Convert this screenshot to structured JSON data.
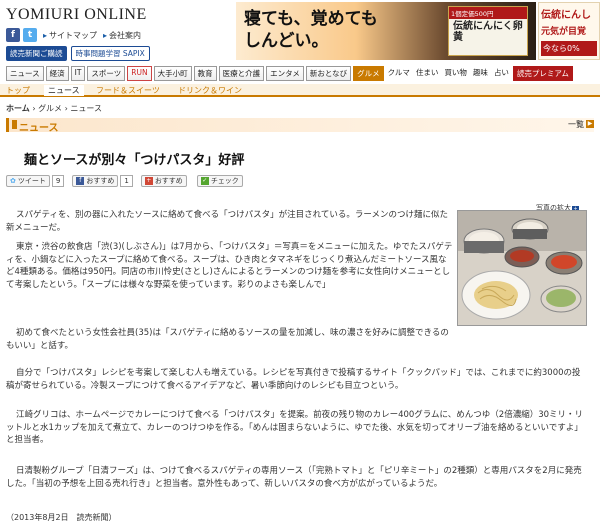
{
  "header": {
    "logo": "YOMIURI ONLINE",
    "social": [
      "f",
      "t"
    ],
    "links": [
      "サイトマップ",
      "会社案内"
    ],
    "btn_subscribe": "読売新聞ご購読",
    "btn_sapix": "時事問題学習 SAPIX"
  },
  "banner": {
    "headline_line1": "寝ても、覚めても",
    "headline_line2": "しんどい。",
    "pack_tag": "1個定価500円",
    "pack_name": "伝統にんにく卵黄",
    "right_1": "伝統にんし",
    "right_2": "元気が目覚",
    "right_3": "今なら0%"
  },
  "nav": {
    "items": [
      "ニュース",
      "経済",
      "IT",
      "スポーツ",
      "RUN",
      "大手小町",
      "教育",
      "医療と介護",
      "エンタメ",
      "新おとなび",
      "グルメ",
      "クルマ",
      "住まい",
      "買い物",
      "趣味",
      "占い",
      "読売プレミアム"
    ],
    "active": "グルメ"
  },
  "subnav": {
    "top": "トップ",
    "news": "ニュース",
    "sweets": "フード＆スイーツ",
    "drink": "ドリンク＆ワイン"
  },
  "breadcrumb": {
    "home": "ホーム",
    "sep": "›",
    "gourmet": "グルメ",
    "news": "ニュース"
  },
  "section": {
    "title": "ニュース",
    "list_link": "一覧"
  },
  "article": {
    "headline": "麺とソースが別々「つけパスタ」好評",
    "share": {
      "tweet": "ツイート",
      "tweet_count": "9",
      "fb_label": "おすすめ",
      "fb_count": "1",
      "g_label": "おすすめ",
      "check_label": "チェック"
    },
    "photo_enlarge": "写真の拡大",
    "paragraphs": [
      "スパゲティを、別の器に入れたソースに絡めて食べる「つけパスタ」が注目されている。ラーメンのつけ麺に似た新メニューだ。",
      "東京・渋谷の飲食店「渋(3)(しぶさん)」は7月から、「つけパスタ」＝写真＝をメニューに加えた。ゆでたスパゲティを、小鍋などに入ったスープに絡めて食べる。スープは、ひき肉とタマネギをじっくり煮込んだミートソース風など4種類ある。価格は950円。同店の市川怜史(さとし)さんによるとラーメンのつけ麺を参考に女性向けメニューとして考案したという。「スープには様々な野菜を使っています。彩りのよさも楽しんで」",
      "初めて食べたという女性会社員(35)は「スパゲティに絡めるソースの量を加減し、味の濃さを好みに調整できるのもいい」と話す。",
      "自分で「つけパスタ」レシピを考案して楽しむ人も増えている。レシピを写真付きで投稿するサイト「クックパッド」では、これまでに約3000の投稿が寄せられている。冷製スープにつけて食べるアイデアなど、暑い季節向けのレシピも目立つという。",
      "江崎グリコは、ホームページでカレーにつけて食べる「つけパスタ」を提案。前夜の残り物のカレー400グラムに、めんつゆ（2倍濃縮）30ミリ・リットルと水1カップを加えて煮立て、カレーのつけつゆを作る。「めんは固まらないように、ゆでた後、水気を切ってオリーブ油を絡めるといいですよ」と担当者。",
      "日清製粉グループ「日清フーズ」は、つけて食べるスパゲティの専用ソース（「完熟トマト」と「ピリ辛ミート」の2種類）と専用パスタを2月に発売した。「当初の予想を上回る売れ行き」と担当者。意外性もあって、新しいパスタの食べ方が広がっているようだ。"
    ],
    "dateline": "（2013年8月2日　読売新聞）"
  },
  "colors": {
    "accent": "#c97a00",
    "brand_blue": "#1c4b94",
    "premium_red": "#b01919"
  }
}
